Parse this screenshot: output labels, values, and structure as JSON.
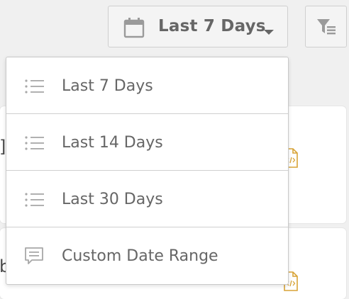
{
  "toolbar": {
    "date_range_label": "Last 7 Days",
    "calendar_icon": "calendar-icon",
    "caret_icon": "caret-down-icon",
    "filter_icon": "filter-list-icon"
  },
  "dropdown": {
    "items": [
      {
        "label": "Last 7 Days",
        "icon": "list-icon"
      },
      {
        "label": "Last 14 Days",
        "icon": "list-icon"
      },
      {
        "label": "Last 30 Days",
        "icon": "list-icon"
      },
      {
        "label": "Custom Date Range",
        "icon": "comment-icon"
      }
    ]
  },
  "background": {
    "card_1_edge_text": "]",
    "card_2_edge_text": "b",
    "file_icon": "code-file-icon"
  },
  "colors": {
    "text": "#666666",
    "icon_gray": "#9a9a9a",
    "file_icon_gold": "#d8a437",
    "border": "#cfcfcf",
    "page_bg": "#f0f0f0"
  }
}
